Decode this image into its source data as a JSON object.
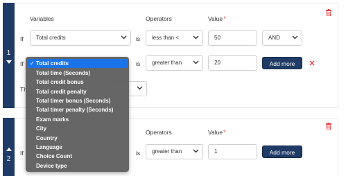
{
  "rule1": {
    "index": "1",
    "headers": {
      "variables": "Variables",
      "operators": "Operators",
      "value": "Value",
      "required_mark": "*"
    },
    "rows": [
      {
        "if_label": "If",
        "variable": "Total credits",
        "is_label": "is",
        "operator": "less than <",
        "value": "50",
        "connector": "AND"
      },
      {
        "if_label": "If",
        "variable": "Total credits",
        "is_label": "is",
        "operator": "greater than",
        "value": "20",
        "add_more_label": "Add more"
      }
    ],
    "then_label": "Th"
  },
  "rule2": {
    "index": "2",
    "headers": {
      "operators": "Operators",
      "value": "Value",
      "required_mark": "*"
    },
    "row": {
      "if_label": "If",
      "is_label": "is",
      "operator": "greater than",
      "value": "1",
      "add_more_label": "Add more"
    }
  },
  "dropdown": {
    "selected": "Total credits",
    "check_mark": "✓",
    "options": [
      "Total time (Seconds)",
      "Total credit bonus",
      "Total credit penalty",
      "Total timer bonus (Seconds)",
      "Total timer penalty (Seconds)",
      "Exam marks",
      "City",
      "Country",
      "Language",
      "Choice Count",
      "Device type"
    ]
  },
  "icons": {
    "delete": "trash-icon",
    "remove": "close-icon",
    "chevron": "chevron-down-icon",
    "collapse": "caret-down-icon",
    "expand": "caret-up-icon"
  },
  "colors": {
    "primary": "#1f3b66",
    "danger": "#e23b3b",
    "highlight": "#1a73e8"
  }
}
